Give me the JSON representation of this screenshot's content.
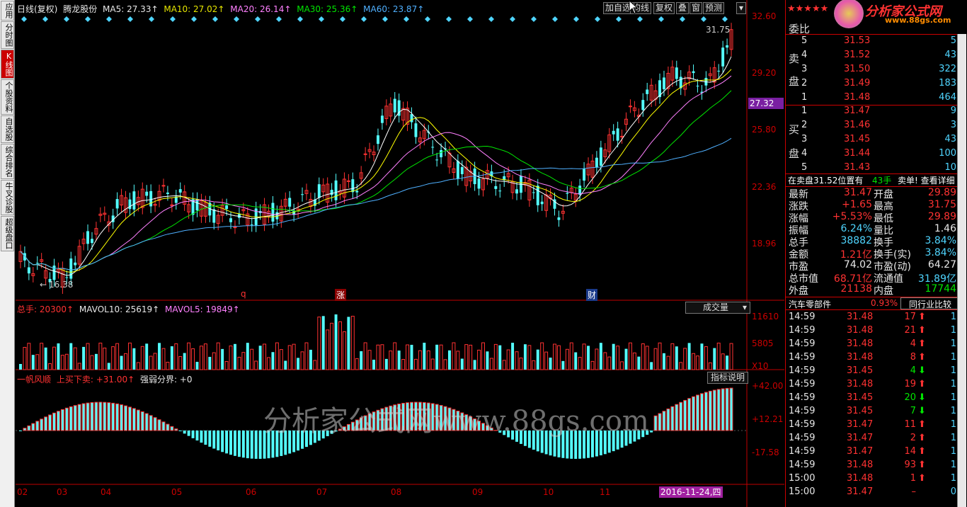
{
  "left_tabs": [
    "应用",
    "分时图",
    "K线图",
    "个股资料",
    "自选股",
    "综合排名",
    "牛叉诊股",
    "超级盘口"
  ],
  "active_tab": "K线图",
  "header": {
    "period": "日线(复权)",
    "stock": "腾龙股份",
    "ma5": "MA5: 27.33↑",
    "ma10": "MA10: 27.02↑",
    "ma20": "MA20: 26.14↑",
    "ma30": "MA30: 25.36↑",
    "ma60": "MA60: 23.87↑"
  },
  "toolbar": [
    "加自选",
    "均线",
    "复权",
    "叠",
    "窗",
    "预测"
  ],
  "price_axis": [
    "32.60",
    "29.20",
    "25.80",
    "22.36",
    "18.96"
  ],
  "current_price_tag": "27.32",
  "high_label": "31.75",
  "low_label": "16.38",
  "event_marks": [
    "q",
    "涨",
    "财"
  ],
  "volume": {
    "total": "总手: 20300↑",
    "mavol10": "MAVOL10: 25619↑",
    "mavol5": "MAVOL5: 19849↑",
    "selector": "成交量",
    "axis": [
      "11610",
      "5805",
      "X10"
    ]
  },
  "indicator": {
    "name": "一帆风顺",
    "buy_sell": "上买下卖: +31.00↑",
    "strength": "强弱分界: +0",
    "help": "指标说明",
    "axis": [
      "+42.00",
      "+12.21",
      "-17.58"
    ]
  },
  "x_axis": [
    "02",
    "03",
    "04",
    "05",
    "06",
    "07",
    "08",
    "09",
    "10",
    "11"
  ],
  "date_tag": "2016-11-24,四",
  "watermark": "分析家公式网www.88gs.com",
  "logo": {
    "text": "分析家公式网",
    "url": "www.88gs.com",
    "stars": "★★★★★"
  },
  "order_book": {
    "title": "委比",
    "sell_label": [
      "卖",
      "盘"
    ],
    "buy_label": [
      "买",
      "盘"
    ],
    "sells": [
      {
        "lvl": "5",
        "price": "31.53",
        "vol": "5"
      },
      {
        "lvl": "4",
        "price": "31.52",
        "vol": "43"
      },
      {
        "lvl": "3",
        "price": "31.50",
        "vol": "322"
      },
      {
        "lvl": "2",
        "price": "31.49",
        "vol": "183"
      },
      {
        "lvl": "1",
        "price": "31.48",
        "vol": "464"
      }
    ],
    "buys": [
      {
        "lvl": "1",
        "price": "31.47",
        "vol": "9"
      },
      {
        "lvl": "2",
        "price": "31.46",
        "vol": "3"
      },
      {
        "lvl": "3",
        "price": "31.45",
        "vol": "43"
      },
      {
        "lvl": "4",
        "price": "31.44",
        "vol": "100"
      },
      {
        "lvl": "5",
        "price": "31.43",
        "vol": "10"
      }
    ]
  },
  "notice": {
    "text": "在卖盘31.52位置有",
    "hands": "43手",
    "link": "卖单! 查看详细"
  },
  "quote": [
    {
      "l": "最新",
      "v": "31.47",
      "l2": "开盘",
      "v2": "29.89"
    },
    {
      "l": "涨跌",
      "v": "+1.65",
      "l2": "最高",
      "v2": "31.75"
    },
    {
      "l": "涨幅",
      "v": "+5.53%",
      "l2": "最低",
      "v2": "29.89"
    },
    {
      "l": "振幅",
      "v": "6.24%",
      "l2": "量比",
      "v2": "1.46"
    },
    {
      "l": "总手",
      "v": "38882",
      "l2": "换手",
      "v2": "3.84%"
    },
    {
      "l": "金额",
      "v": "1.21亿",
      "l2": "换手(实)",
      "v2": "3.84%"
    },
    {
      "l": "市盈",
      "v": "74.02",
      "l2": "市盈(动)",
      "v2": "64.27"
    },
    {
      "l": "总市值",
      "v": "68.71亿",
      "l2": "流通值",
      "v2": "31.89亿"
    },
    {
      "l": "外盘",
      "v": "21138",
      "l2": "内盘",
      "v2": "17744"
    }
  ],
  "industry": {
    "name": "汽车零部件",
    "pct": "0.93%",
    "compare": "同行业比较"
  },
  "ticks": [
    {
      "t": "14:59",
      "p": "31.48",
      "v": "17",
      "d": "up",
      "n": "1"
    },
    {
      "t": "14:59",
      "p": "31.48",
      "v": "21",
      "d": "up",
      "n": "1"
    },
    {
      "t": "14:59",
      "p": "31.48",
      "v": "4",
      "d": "up",
      "n": "1"
    },
    {
      "t": "14:59",
      "p": "31.48",
      "v": "8",
      "d": "up",
      "n": "1"
    },
    {
      "t": "14:59",
      "p": "31.45",
      "v": "4",
      "d": "down",
      "n": "1"
    },
    {
      "t": "14:59",
      "p": "31.48",
      "v": "19",
      "d": "up",
      "n": "1"
    },
    {
      "t": "14:59",
      "p": "31.45",
      "v": "20",
      "d": "down",
      "n": "1"
    },
    {
      "t": "14:59",
      "p": "31.45",
      "v": "7",
      "d": "down",
      "n": "1"
    },
    {
      "t": "14:59",
      "p": "31.47",
      "v": "11",
      "d": "up",
      "n": "1"
    },
    {
      "t": "14:59",
      "p": "31.47",
      "v": "2",
      "d": "up",
      "n": "1"
    },
    {
      "t": "14:59",
      "p": "31.47",
      "v": "14",
      "d": "up",
      "n": "1"
    },
    {
      "t": "14:59",
      "p": "31.48",
      "v": "93",
      "d": "up",
      "n": "1"
    },
    {
      "t": "15:00",
      "p": "31.48",
      "v": "1",
      "d": "up",
      "n": "1"
    },
    {
      "t": "15:00",
      "p": "31.47",
      "v": "–",
      "d": "none",
      "n": "0"
    }
  ],
  "colors": {
    "up": "#ff3232",
    "down": "#54ffff",
    "ma5": "#ffffff",
    "ma10": "#ffff00",
    "ma20": "#ff80ff",
    "ma30": "#00e600",
    "ma60": "#4fb0ff",
    "axis": "#c00000"
  }
}
